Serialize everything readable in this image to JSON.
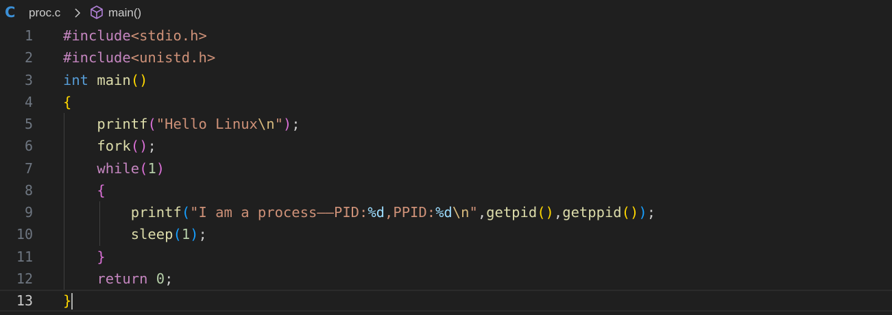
{
  "breadcrumb": {
    "lang_glyph": "C",
    "file": "proc.c",
    "symbol": "main()"
  },
  "editor": {
    "current_line": 13,
    "lines": [
      {
        "number": "1",
        "tokens": [
          {
            "t": "#include",
            "c": "t-pre"
          },
          {
            "t": "<stdio.h>",
            "c": "t-inc"
          }
        ]
      },
      {
        "number": "2",
        "tokens": [
          {
            "t": "#include",
            "c": "t-pre"
          },
          {
            "t": "<unistd.h>",
            "c": "t-inc"
          }
        ]
      },
      {
        "number": "3",
        "tokens": [
          {
            "t": "int",
            "c": "t-kw"
          },
          {
            "t": " ",
            "c": "t-p"
          },
          {
            "t": "main",
            "c": "t-fn"
          },
          {
            "t": "()",
            "c": "t-b1"
          }
        ]
      },
      {
        "number": "4",
        "tokens": [
          {
            "t": "{",
            "c": "t-b1"
          }
        ]
      },
      {
        "number": "5",
        "tokens": [
          {
            "t": "    ",
            "c": "t-p"
          },
          {
            "t": "printf",
            "c": "t-fn"
          },
          {
            "t": "(",
            "c": "t-b2"
          },
          {
            "t": "\"Hello Linux",
            "c": "t-str"
          },
          {
            "t": "\\n",
            "c": "t-esc"
          },
          {
            "t": "\"",
            "c": "t-str"
          },
          {
            "t": ")",
            "c": "t-b2"
          },
          {
            "t": ";",
            "c": "t-p"
          }
        ]
      },
      {
        "number": "6",
        "tokens": [
          {
            "t": "    ",
            "c": "t-p"
          },
          {
            "t": "fork",
            "c": "t-fn"
          },
          {
            "t": "()",
            "c": "t-b2"
          },
          {
            "t": ";",
            "c": "t-p"
          }
        ]
      },
      {
        "number": "7",
        "tokens": [
          {
            "t": "    ",
            "c": "t-p"
          },
          {
            "t": "while",
            "c": "t-ctl"
          },
          {
            "t": "(",
            "c": "t-b2"
          },
          {
            "t": "1",
            "c": "t-num"
          },
          {
            "t": ")",
            "c": "t-b2"
          }
        ]
      },
      {
        "number": "8",
        "tokens": [
          {
            "t": "    ",
            "c": "t-p"
          },
          {
            "t": "{",
            "c": "t-b2"
          }
        ]
      },
      {
        "number": "9",
        "tokens": [
          {
            "t": "        ",
            "c": "t-p"
          },
          {
            "t": "printf",
            "c": "t-fn"
          },
          {
            "t": "(",
            "c": "t-b3"
          },
          {
            "t": "\"I am a process——PID:",
            "c": "t-str"
          },
          {
            "t": "%d",
            "c": "t-fmt"
          },
          {
            "t": ",PPID:",
            "c": "t-str"
          },
          {
            "t": "%d",
            "c": "t-fmt"
          },
          {
            "t": "\\n",
            "c": "t-esc"
          },
          {
            "t": "\"",
            "c": "t-str"
          },
          {
            "t": ",",
            "c": "t-p"
          },
          {
            "t": "getpid",
            "c": "t-fn"
          },
          {
            "t": "()",
            "c": "t-b1"
          },
          {
            "t": ",",
            "c": "t-p"
          },
          {
            "t": "getppid",
            "c": "t-fn"
          },
          {
            "t": "()",
            "c": "t-b1"
          },
          {
            "t": ")",
            "c": "t-b3"
          },
          {
            "t": ";",
            "c": "t-p"
          }
        ]
      },
      {
        "number": "10",
        "tokens": [
          {
            "t": "        ",
            "c": "t-p"
          },
          {
            "t": "sleep",
            "c": "t-fn"
          },
          {
            "t": "(",
            "c": "t-b3"
          },
          {
            "t": "1",
            "c": "t-num"
          },
          {
            "t": ")",
            "c": "t-b3"
          },
          {
            "t": ";",
            "c": "t-p"
          }
        ]
      },
      {
        "number": "11",
        "tokens": [
          {
            "t": "    ",
            "c": "t-p"
          },
          {
            "t": "}",
            "c": "t-b2"
          }
        ]
      },
      {
        "number": "12",
        "tokens": [
          {
            "t": "    ",
            "c": "t-p"
          },
          {
            "t": "return",
            "c": "t-ctl"
          },
          {
            "t": " ",
            "c": "t-p"
          },
          {
            "t": "0",
            "c": "t-num"
          },
          {
            "t": ";",
            "c": "t-p"
          }
        ]
      },
      {
        "number": "13",
        "tokens": [
          {
            "t": "}",
            "c": "t-b1"
          }
        ]
      }
    ]
  },
  "colors": {
    "background": "#1f1f1f",
    "line_number": "#6e7681",
    "line_number_active": "#cccccc",
    "keyword": "#569cd6",
    "control": "#c586c0",
    "function": "#dcdcaa",
    "string": "#ce9178",
    "number": "#b5cea8",
    "bracket_1": "#ffd700",
    "bracket_2": "#da70d6",
    "bracket_3": "#179fff"
  }
}
